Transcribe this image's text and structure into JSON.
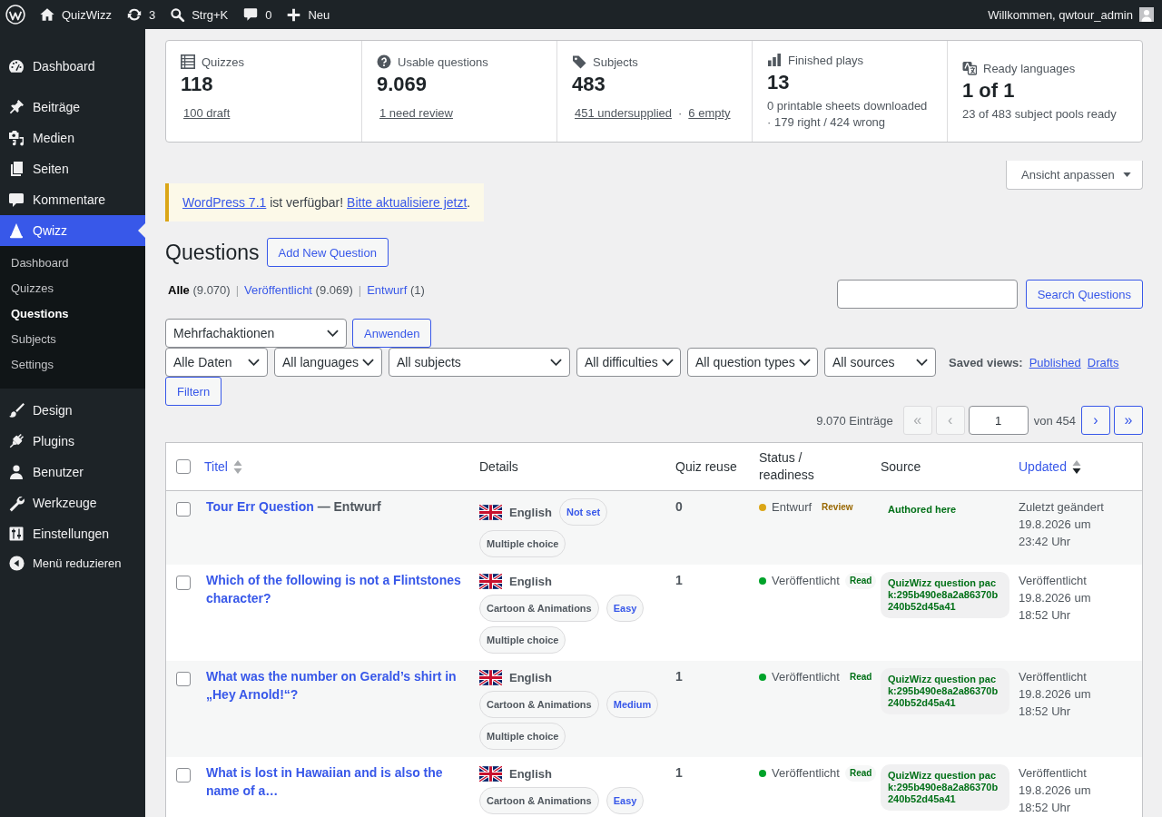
{
  "admin_bar": {
    "site_name": "QuizWizz",
    "updates": "3",
    "search_shortcut": "Strg+K",
    "comments": "0",
    "new_label": "Neu",
    "greeting": "Willkommen, qwtour_admin"
  },
  "sidebar": {
    "groups": [
      [
        {
          "kind": "dashboard",
          "label": "Dashboard",
          "selected": false
        }
      ],
      [
        {
          "kind": "posts",
          "label": "Beiträge",
          "selected": false
        },
        {
          "kind": "media",
          "label": "Medien",
          "selected": false
        },
        {
          "kind": "pages",
          "label": "Seiten",
          "selected": false
        },
        {
          "kind": "comments",
          "label": "Kommentare",
          "selected": false
        },
        {
          "kind": "quiz",
          "label": "Qwizz",
          "selected": true,
          "children": [
            {
              "label": "Dashboard",
              "selected": false
            },
            {
              "label": "Quizzes",
              "selected": false
            },
            {
              "label": "Questions",
              "selected": true
            },
            {
              "label": "Subjects",
              "selected": false
            },
            {
              "label": "Settings",
              "selected": false
            }
          ]
        },
        {
          "kind": "appearance",
          "label": "Design",
          "selected": false
        },
        {
          "kind": "plugins",
          "label": "Plugins",
          "selected": false
        },
        {
          "kind": "users",
          "label": "Benutzer",
          "selected": false
        },
        {
          "kind": "tools",
          "label": "Werkzeuge",
          "selected": false
        },
        {
          "kind": "settings",
          "label": "Einstellungen",
          "selected": false
        }
      ]
    ],
    "collapse_label": "Menü reduzieren"
  },
  "stats": [
    {
      "kind": "quizzes",
      "label": "Quizzes",
      "value": "118",
      "links": [
        "100 draft"
      ]
    },
    {
      "kind": "questions",
      "label": "Usable questions",
      "value": "9.069",
      "links": [
        "1 need review"
      ]
    },
    {
      "kind": "subjects",
      "label": "Subjects",
      "value": "483",
      "links": [
        "451 undersupplied",
        "6 empty"
      ],
      "separator": "·"
    },
    {
      "kind": "plays",
      "label": "Finished plays",
      "value": "13",
      "note": "0 printable sheets downloaded · 179 right / 424 wrong"
    },
    {
      "kind": "languages",
      "label": "Ready languages",
      "value": "1 of 1",
      "note": "23 of 483 subject pools ready"
    }
  ],
  "screen_options": {
    "label": "Ansicht anpassen"
  },
  "notice": {
    "parts": [
      {
        "kind": "link",
        "text": "WordPress 7.1"
      },
      {
        "kind": "text",
        "text": " ist verfügbar! "
      },
      {
        "kind": "link",
        "text": "Bitte aktualisiere jetzt"
      },
      {
        "kind": "text",
        "text": "."
      }
    ]
  },
  "page": {
    "title": "Questions",
    "add_button": "Add New Question"
  },
  "status_filters": [
    {
      "label": "Alle",
      "count": "(9.070)",
      "selected": true,
      "separator": "|"
    },
    {
      "label": "Veröffentlicht",
      "count": "(9.069)",
      "selected": false,
      "separator": "|"
    },
    {
      "label": "Entwurf",
      "count": "(1)",
      "selected": false
    }
  ],
  "search": {
    "button": "Search Questions"
  },
  "bulk_actions": {
    "value": "Mehrfachaktionen",
    "button": "Anwenden"
  },
  "filters": {
    "selects": [
      "Alle Daten",
      "All languages",
      "All subjects",
      "All difficulties",
      "All question types",
      "All sources"
    ],
    "saved_views_label": "Saved views:",
    "saved_views": [
      "Published",
      "Drafts"
    ],
    "button": "Filtern"
  },
  "pagination": {
    "total": "9.070 Einträge",
    "first": {
      "label": "«",
      "disabled": true
    },
    "prev": {
      "label": "‹",
      "disabled": true
    },
    "page": "1",
    "of": "von 454",
    "next": {
      "label": "›",
      "disabled": false
    },
    "last": {
      "label": "»",
      "disabled": false
    }
  },
  "table": {
    "select_all_checked": false,
    "columns": [
      {
        "label": "Titel",
        "sortable": true,
        "sorted": false
      },
      {
        "label": "Details",
        "sortable": false
      },
      {
        "label": "Quiz reuse",
        "sortable": false
      },
      {
        "label": "Status / readiness",
        "sortable": false
      },
      {
        "label": "Source",
        "sortable": false
      },
      {
        "label": "Updated",
        "sortable": true,
        "sorted": true
      }
    ],
    "rows": [
      {
        "checked": false,
        "title": "Tour Err Question",
        "post_state": "— Entwurf",
        "language": "English",
        "tags": [
          {
            "kind": "difficulty",
            "text": "Not set"
          },
          {
            "kind": "type",
            "text": "Multiple choice"
          }
        ],
        "reuse": "0",
        "status": {
          "label": "Entwurf",
          "color": "#dba617"
        },
        "readiness": {
          "kind": "review",
          "text": "Review"
        },
        "source": {
          "kind": "authored",
          "text": "Authored here"
        },
        "updated": [
          "Zuletzt geändert",
          "19.8.2026 um",
          "23:42 Uhr"
        ]
      },
      {
        "checked": false,
        "title": "Which of the following is not a Flintstones character?",
        "language": "English",
        "tags": [
          {
            "kind": "subject",
            "text": "Cartoon & Animations"
          },
          {
            "kind": "difficulty",
            "text": "Easy"
          },
          {
            "kind": "type",
            "text": "Multiple choice"
          }
        ],
        "reuse": "1",
        "status": {
          "label": "Veröffentlicht",
          "color": "#00a32a"
        },
        "readiness": {
          "kind": "ready",
          "text": "Read"
        },
        "source": {
          "kind": "pack",
          "text": "QuizWizz question pack:295b490e8a2a86370b240b52d45a41"
        },
        "updated": [
          "Veröffentlicht",
          "19.8.2026 um",
          "18:52 Uhr"
        ]
      },
      {
        "checked": false,
        "title": "What was the number on Gerald’s shirt in „Hey Arnold!“?",
        "language": "English",
        "tags": [
          {
            "kind": "subject",
            "text": "Cartoon & Animations"
          },
          {
            "kind": "difficulty",
            "text": "Medium"
          },
          {
            "kind": "type",
            "text": "Multiple choice"
          }
        ],
        "reuse": "1",
        "status": {
          "label": "Veröffentlicht",
          "color": "#00a32a"
        },
        "readiness": {
          "kind": "ready",
          "text": "Read"
        },
        "source": {
          "kind": "pack",
          "text": "QuizWizz question pack:295b490e8a2a86370b240b52d45a41"
        },
        "updated": [
          "Veröffentlicht",
          "19.8.2026 um",
          "18:52 Uhr"
        ]
      },
      {
        "checked": false,
        "title": "What is lost in Hawaiian and is also the name of a…",
        "language": "English",
        "tags": [
          {
            "kind": "subject",
            "text": "Cartoon & Animations"
          },
          {
            "kind": "difficulty",
            "text": "Easy"
          }
        ],
        "reuse": "1",
        "status": {
          "label": "Veröffentlicht",
          "color": "#00a32a"
        },
        "readiness": {
          "kind": "ready",
          "text": "Read"
        },
        "source": {
          "kind": "pack",
          "text": "QuizWizz question pack:295b490e8a2a86370b240b52d45a41"
        },
        "updated": [
          "Veröffentlicht",
          "19.8.2026 um",
          "18:52 Uhr"
        ]
      }
    ]
  }
}
